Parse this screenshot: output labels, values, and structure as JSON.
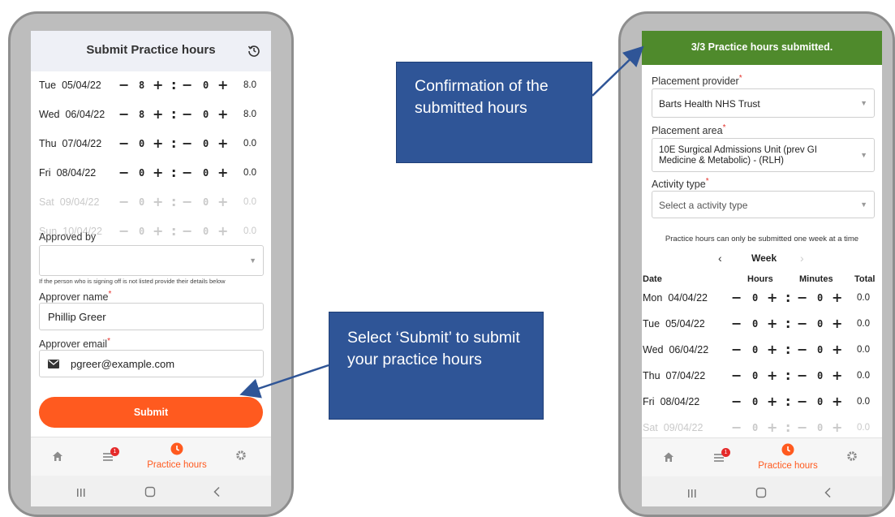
{
  "left": {
    "header": {
      "title": "Submit Practice hours",
      "history_icon": "history-icon"
    },
    "rows": [
      {
        "day": "Tue",
        "date": "05/04/22",
        "hours": "8",
        "minutes": "0",
        "total": "8.0",
        "dimmed": false
      },
      {
        "day": "Wed",
        "date": "06/04/22",
        "hours": "8",
        "minutes": "0",
        "total": "8.0",
        "dimmed": false
      },
      {
        "day": "Thu",
        "date": "07/04/22",
        "hours": "0",
        "minutes": "0",
        "total": "0.0",
        "dimmed": false
      },
      {
        "day": "Fri",
        "date": "08/04/22",
        "hours": "0",
        "minutes": "0",
        "total": "0.0",
        "dimmed": false
      },
      {
        "day": "Sat",
        "date": "09/04/22",
        "hours": "0",
        "minutes": "0",
        "total": "0.0",
        "dimmed": true
      },
      {
        "day": "Sun",
        "date": "10/04/22",
        "hours": "0",
        "minutes": "0",
        "total": "0.0",
        "dimmed": true
      }
    ],
    "approved_by_label": "Approved by",
    "approved_by_value": "",
    "helper_text": "If the person who is signing off is not listed provide their details below",
    "approver_name_label": "Approver name",
    "approver_name_value": "Phillip Greer",
    "approver_email_label": "Approver email",
    "approver_email_value": "pgreer@example.com",
    "submit_label": "Submit",
    "nav": {
      "active_label": "Practice hours",
      "badge": "1"
    }
  },
  "right": {
    "banner": "3/3 Practice hours submitted.",
    "placement_provider_label": "Placement provider",
    "placement_provider_value": "Barts Health NHS Trust",
    "placement_area_label": "Placement area",
    "placement_area_line1": "10E Surgical Admissions Unit (prev GI",
    "placement_area_line2": "Medicine & Metabolic) - (RLH)",
    "activity_type_label": "Activity type",
    "activity_type_placeholder": "Select a activity type",
    "notice": "Practice hours can only be submitted one week at a time",
    "week_label": "Week",
    "columns": {
      "date": "Date",
      "hours": "Hours",
      "minutes": "Minutes",
      "total": "Total"
    },
    "rows": [
      {
        "day": "Mon",
        "date": "04/04/22",
        "hours": "0",
        "minutes": "0",
        "total": "0.0",
        "dimmed": false
      },
      {
        "day": "Tue",
        "date": "05/04/22",
        "hours": "0",
        "minutes": "0",
        "total": "0.0",
        "dimmed": false
      },
      {
        "day": "Wed",
        "date": "06/04/22",
        "hours": "0",
        "minutes": "0",
        "total": "0.0",
        "dimmed": false
      },
      {
        "day": "Thu",
        "date": "07/04/22",
        "hours": "0",
        "minutes": "0",
        "total": "0.0",
        "dimmed": false
      },
      {
        "day": "Fri",
        "date": "08/04/22",
        "hours": "0",
        "minutes": "0",
        "total": "0.0",
        "dimmed": false
      },
      {
        "day": "Sat",
        "date": "09/04/22",
        "hours": "0",
        "minutes": "0",
        "total": "0.0",
        "dimmed": true
      }
    ],
    "nav": {
      "active_label": "Practice hours",
      "badge": "1"
    }
  },
  "callouts": {
    "confirmation": "Confirmation of the submitted hours",
    "submit": "Select ‘Submit’ to submit your practice hours"
  },
  "colors": {
    "accent": "#ff5a1f",
    "banner": "#4f8a2c",
    "callout": "#2f5597",
    "header_bg": "#eef0f6"
  }
}
